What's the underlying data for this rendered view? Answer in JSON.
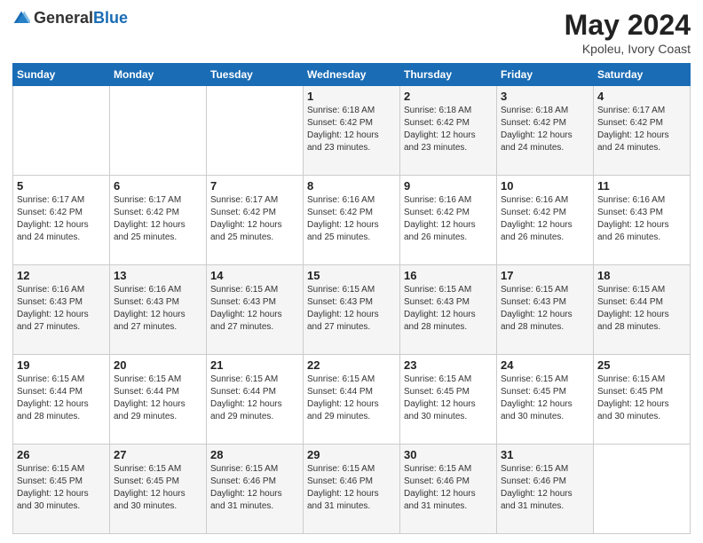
{
  "header": {
    "logo_general": "General",
    "logo_blue": "Blue",
    "month_year": "May 2024",
    "location": "Kpoleu, Ivory Coast"
  },
  "weekdays": [
    "Sunday",
    "Monday",
    "Tuesday",
    "Wednesday",
    "Thursday",
    "Friday",
    "Saturday"
  ],
  "weeks": [
    [
      {
        "day": "",
        "sunrise": "",
        "sunset": "",
        "daylight": ""
      },
      {
        "day": "",
        "sunrise": "",
        "sunset": "",
        "daylight": ""
      },
      {
        "day": "",
        "sunrise": "",
        "sunset": "",
        "daylight": ""
      },
      {
        "day": "1",
        "sunrise": "Sunrise: 6:18 AM",
        "sunset": "Sunset: 6:42 PM",
        "daylight": "Daylight: 12 hours and 23 minutes."
      },
      {
        "day": "2",
        "sunrise": "Sunrise: 6:18 AM",
        "sunset": "Sunset: 6:42 PM",
        "daylight": "Daylight: 12 hours and 23 minutes."
      },
      {
        "day": "3",
        "sunrise": "Sunrise: 6:18 AM",
        "sunset": "Sunset: 6:42 PM",
        "daylight": "Daylight: 12 hours and 24 minutes."
      },
      {
        "day": "4",
        "sunrise": "Sunrise: 6:17 AM",
        "sunset": "Sunset: 6:42 PM",
        "daylight": "Daylight: 12 hours and 24 minutes."
      }
    ],
    [
      {
        "day": "5",
        "sunrise": "Sunrise: 6:17 AM",
        "sunset": "Sunset: 6:42 PM",
        "daylight": "Daylight: 12 hours and 24 minutes."
      },
      {
        "day": "6",
        "sunrise": "Sunrise: 6:17 AM",
        "sunset": "Sunset: 6:42 PM",
        "daylight": "Daylight: 12 hours and 25 minutes."
      },
      {
        "day": "7",
        "sunrise": "Sunrise: 6:17 AM",
        "sunset": "Sunset: 6:42 PM",
        "daylight": "Daylight: 12 hours and 25 minutes."
      },
      {
        "day": "8",
        "sunrise": "Sunrise: 6:16 AM",
        "sunset": "Sunset: 6:42 PM",
        "daylight": "Daylight: 12 hours and 25 minutes."
      },
      {
        "day": "9",
        "sunrise": "Sunrise: 6:16 AM",
        "sunset": "Sunset: 6:42 PM",
        "daylight": "Daylight: 12 hours and 26 minutes."
      },
      {
        "day": "10",
        "sunrise": "Sunrise: 6:16 AM",
        "sunset": "Sunset: 6:42 PM",
        "daylight": "Daylight: 12 hours and 26 minutes."
      },
      {
        "day": "11",
        "sunrise": "Sunrise: 6:16 AM",
        "sunset": "Sunset: 6:43 PM",
        "daylight": "Daylight: 12 hours and 26 minutes."
      }
    ],
    [
      {
        "day": "12",
        "sunrise": "Sunrise: 6:16 AM",
        "sunset": "Sunset: 6:43 PM",
        "daylight": "Daylight: 12 hours and 27 minutes."
      },
      {
        "day": "13",
        "sunrise": "Sunrise: 6:16 AM",
        "sunset": "Sunset: 6:43 PM",
        "daylight": "Daylight: 12 hours and 27 minutes."
      },
      {
        "day": "14",
        "sunrise": "Sunrise: 6:15 AM",
        "sunset": "Sunset: 6:43 PM",
        "daylight": "Daylight: 12 hours and 27 minutes."
      },
      {
        "day": "15",
        "sunrise": "Sunrise: 6:15 AM",
        "sunset": "Sunset: 6:43 PM",
        "daylight": "Daylight: 12 hours and 27 minutes."
      },
      {
        "day": "16",
        "sunrise": "Sunrise: 6:15 AM",
        "sunset": "Sunset: 6:43 PM",
        "daylight": "Daylight: 12 hours and 28 minutes."
      },
      {
        "day": "17",
        "sunrise": "Sunrise: 6:15 AM",
        "sunset": "Sunset: 6:43 PM",
        "daylight": "Daylight: 12 hours and 28 minutes."
      },
      {
        "day": "18",
        "sunrise": "Sunrise: 6:15 AM",
        "sunset": "Sunset: 6:44 PM",
        "daylight": "Daylight: 12 hours and 28 minutes."
      }
    ],
    [
      {
        "day": "19",
        "sunrise": "Sunrise: 6:15 AM",
        "sunset": "Sunset: 6:44 PM",
        "daylight": "Daylight: 12 hours and 28 minutes."
      },
      {
        "day": "20",
        "sunrise": "Sunrise: 6:15 AM",
        "sunset": "Sunset: 6:44 PM",
        "daylight": "Daylight: 12 hours and 29 minutes."
      },
      {
        "day": "21",
        "sunrise": "Sunrise: 6:15 AM",
        "sunset": "Sunset: 6:44 PM",
        "daylight": "Daylight: 12 hours and 29 minutes."
      },
      {
        "day": "22",
        "sunrise": "Sunrise: 6:15 AM",
        "sunset": "Sunset: 6:44 PM",
        "daylight": "Daylight: 12 hours and 29 minutes."
      },
      {
        "day": "23",
        "sunrise": "Sunrise: 6:15 AM",
        "sunset": "Sunset: 6:45 PM",
        "daylight": "Daylight: 12 hours and 30 minutes."
      },
      {
        "day": "24",
        "sunrise": "Sunrise: 6:15 AM",
        "sunset": "Sunset: 6:45 PM",
        "daylight": "Daylight: 12 hours and 30 minutes."
      },
      {
        "day": "25",
        "sunrise": "Sunrise: 6:15 AM",
        "sunset": "Sunset: 6:45 PM",
        "daylight": "Daylight: 12 hours and 30 minutes."
      }
    ],
    [
      {
        "day": "26",
        "sunrise": "Sunrise: 6:15 AM",
        "sunset": "Sunset: 6:45 PM",
        "daylight": "Daylight: 12 hours and 30 minutes."
      },
      {
        "day": "27",
        "sunrise": "Sunrise: 6:15 AM",
        "sunset": "Sunset: 6:45 PM",
        "daylight": "Daylight: 12 hours and 30 minutes."
      },
      {
        "day": "28",
        "sunrise": "Sunrise: 6:15 AM",
        "sunset": "Sunset: 6:46 PM",
        "daylight": "Daylight: 12 hours and 31 minutes."
      },
      {
        "day": "29",
        "sunrise": "Sunrise: 6:15 AM",
        "sunset": "Sunset: 6:46 PM",
        "daylight": "Daylight: 12 hours and 31 minutes."
      },
      {
        "day": "30",
        "sunrise": "Sunrise: 6:15 AM",
        "sunset": "Sunset: 6:46 PM",
        "daylight": "Daylight: 12 hours and 31 minutes."
      },
      {
        "day": "31",
        "sunrise": "Sunrise: 6:15 AM",
        "sunset": "Sunset: 6:46 PM",
        "daylight": "Daylight: 12 hours and 31 minutes."
      },
      {
        "day": "",
        "sunrise": "",
        "sunset": "",
        "daylight": ""
      }
    ]
  ]
}
